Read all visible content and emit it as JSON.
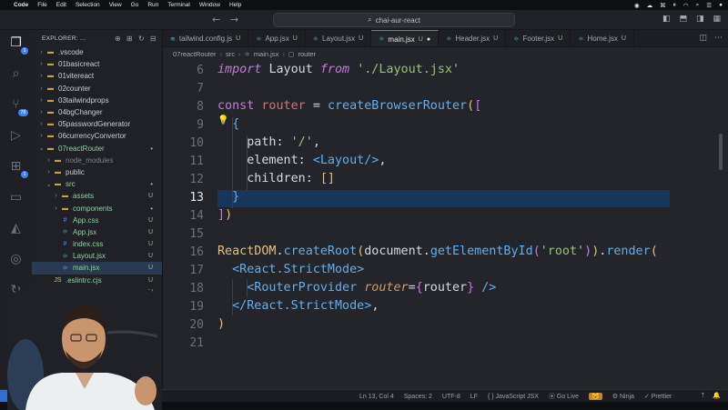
{
  "menubar": {
    "app": "Code",
    "items": [
      "File",
      "Edit",
      "Selection",
      "View",
      "Go",
      "Run",
      "Terminal",
      "Window",
      "Help"
    ]
  },
  "titlebar": {
    "search": "chai-aur-react"
  },
  "activity": {
    "explorer_badge": "1",
    "scm_badge": "78",
    "ext_badge": "1"
  },
  "sidebar": {
    "title": "EXPLORER: ...",
    "rows": [
      {
        "label": ".vscode",
        "type": "folder",
        "open": false,
        "depth": 1,
        "status": ""
      },
      {
        "label": "01basicreact",
        "type": "folder",
        "open": false,
        "depth": 1,
        "status": ""
      },
      {
        "label": "01vitereact",
        "type": "folder",
        "open": false,
        "depth": 1,
        "status": ""
      },
      {
        "label": "02counter",
        "type": "folder",
        "open": false,
        "depth": 1,
        "status": ""
      },
      {
        "label": "03tailwindprops",
        "type": "folder",
        "open": false,
        "depth": 1,
        "status": ""
      },
      {
        "label": "04bgChanger",
        "type": "folder",
        "open": false,
        "depth": 1,
        "status": ""
      },
      {
        "label": "05passwordGenerator",
        "type": "folder",
        "open": false,
        "depth": 1,
        "status": ""
      },
      {
        "label": "06currencyConvertor",
        "type": "folder",
        "open": false,
        "depth": 1,
        "status": ""
      },
      {
        "label": "07reactRouter",
        "type": "folder",
        "open": true,
        "depth": 1,
        "status": "•"
      },
      {
        "label": "node_modules",
        "type": "folder",
        "open": false,
        "depth": 2,
        "status": "",
        "muted": true
      },
      {
        "label": "public",
        "type": "folder",
        "open": false,
        "depth": 2,
        "status": ""
      },
      {
        "label": "src",
        "type": "folder",
        "open": true,
        "depth": 2,
        "status": "•"
      },
      {
        "label": "assets",
        "type": "folder",
        "open": false,
        "depth": 3,
        "status": "U"
      },
      {
        "label": "components",
        "type": "folder",
        "open": false,
        "depth": 3,
        "status": "•"
      },
      {
        "label": "App.css",
        "type": "css",
        "depth": 3,
        "status": "U"
      },
      {
        "label": "App.jsx",
        "type": "jsx",
        "depth": 3,
        "status": "U"
      },
      {
        "label": "index.css",
        "type": "css",
        "depth": 3,
        "status": "U"
      },
      {
        "label": "Layout.jsx",
        "type": "jsx",
        "depth": 3,
        "status": "U"
      },
      {
        "label": "main.jsx",
        "type": "jsx",
        "depth": 3,
        "status": "U",
        "selected": true
      },
      {
        "label": ".eslintrc.cjs",
        "type": "js",
        "depth": 2,
        "status": "U"
      },
      {
        "label": ".gitignore",
        "type": "git",
        "depth": 2,
        "status": "U"
      },
      {
        "label": "x.html",
        "type": "html",
        "depth": 2,
        "status": "U"
      },
      {
        "label": "ge-lock.json",
        "type": "json",
        "depth": 2,
        "status": "U"
      },
      {
        "label": "ge.json",
        "type": "json",
        "depth": 2,
        "status": "U"
      },
      {
        "label": "fig.js",
        "type": "js",
        "depth": 2,
        "status": "U"
      },
      {
        "label": "",
        "type": "none",
        "depth": 2,
        "status": "U"
      },
      {
        "label": "js",
        "type": "js",
        "depth": 2,
        "status": "U"
      }
    ]
  },
  "tabs": [
    {
      "label": "tailwind.config.js",
      "status": "U",
      "active": false
    },
    {
      "label": "App.jsx",
      "status": "U",
      "active": false
    },
    {
      "label": "Layout.jsx",
      "status": "U",
      "active": false
    },
    {
      "label": "main.jsx",
      "status": "U",
      "active": true,
      "dirty": true
    },
    {
      "label": "Header.jsx",
      "status": "U",
      "active": false
    },
    {
      "label": "Footer.jsx",
      "status": "U",
      "active": false
    },
    {
      "label": "Home.jsx",
      "status": "U",
      "active": false
    }
  ],
  "breadcrumb": [
    "07reactRouter",
    "src",
    "main.jsx",
    "router"
  ],
  "editor": {
    "line_numbers": [
      "6",
      "7",
      "8",
      "9",
      "10",
      "11",
      "12",
      "13",
      "14",
      "15",
      "16",
      "17",
      "18",
      "19",
      "20",
      "21"
    ],
    "current_line": "13"
  },
  "statusbar": {
    "position": "Ln 13, Col 4",
    "spaces": "Spaces: 2",
    "encoding": "UTF-8",
    "eol": "LF",
    "language": "{ }  JavaScript JSX",
    "golive": "Go Live",
    "ninja": "Ninja",
    "prettier": "Prettier"
  }
}
